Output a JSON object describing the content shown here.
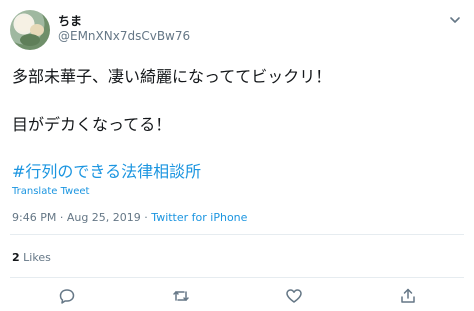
{
  "user": {
    "display_name": "ちま",
    "handle": "@EMnXNx7dsCvBw76"
  },
  "tweet": {
    "line1": "多部未華子、凄い綺麗になっててビックリ！",
    "line2": "目がデカくなってる！",
    "hashtag": "#行列のできる法律相談所",
    "translate_label": "Translate Tweet",
    "time": "9:46 PM",
    "date": "Aug 25, 2019",
    "source": "Twitter for iPhone",
    "separator": "·"
  },
  "stats": {
    "likes_count": "2",
    "likes_label": "Likes"
  },
  "icons": {
    "menu": "chevron-down-icon",
    "reply": "reply-icon",
    "retweet": "retweet-icon",
    "like": "heart-icon",
    "share": "share-icon"
  },
  "colors": {
    "link": "#1b95e0",
    "muted": "#657786",
    "text": "#14171a",
    "divider": "#e6ecf0"
  }
}
